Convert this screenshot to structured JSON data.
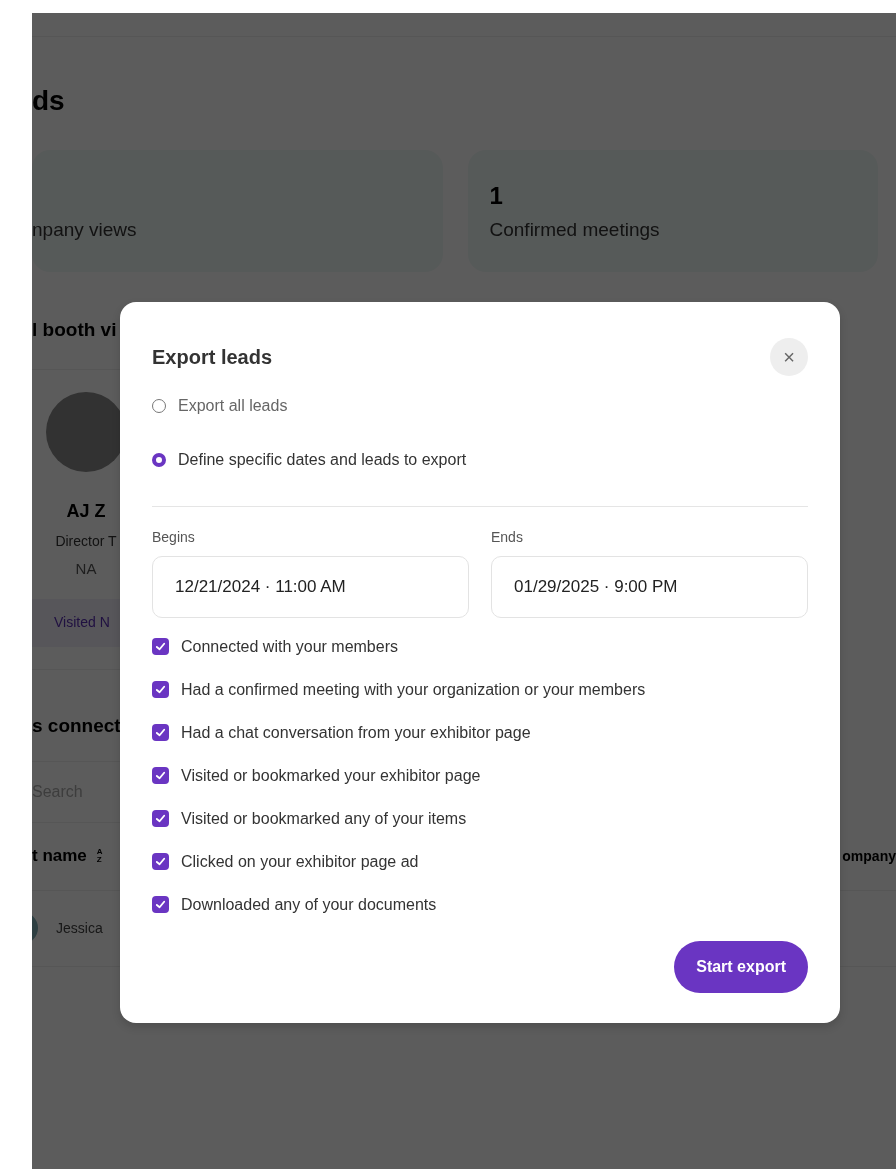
{
  "page": {
    "heading": "ds",
    "stats": [
      {
        "label": "npany views"
      },
      {
        "value": "1",
        "label": "Confirmed meetings"
      }
    ],
    "booth_heading": "l booth vi",
    "person": {
      "name": "AJ Z",
      "title": "Director T",
      "company": "NA",
      "tag": "Visited N"
    },
    "connect_heading": "s connect",
    "search": {
      "placeholder": "Search"
    },
    "table": {
      "columns": [
        {
          "label": "t name",
          "sort": [
            "A",
            "Z"
          ]
        },
        {
          "label": "ompany"
        }
      ],
      "rows": [
        {
          "name": "Jessica"
        }
      ]
    }
  },
  "dialog": {
    "title": "Export leads",
    "close": "×",
    "options": [
      {
        "label": "Export all leads",
        "selected": false
      },
      {
        "label": "Define specific dates and leads to export",
        "selected": true
      }
    ],
    "begins": {
      "label": "Begins",
      "value": "12/21/2024 · 11:00 AM"
    },
    "ends": {
      "label": "Ends",
      "value": "01/29/2025 · 9:00 PM"
    },
    "filters": [
      {
        "label": "Connected with your members",
        "checked": true
      },
      {
        "label": "Had a confirmed meeting with your organization or your members",
        "checked": true
      },
      {
        "label": "Had a chat conversation from your exhibitor page",
        "checked": true
      },
      {
        "label": "Visited or bookmarked your exhibitor page",
        "checked": true
      },
      {
        "label": "Visited or bookmarked any of your items",
        "checked": true
      },
      {
        "label": "Clicked on your exhibitor page ad",
        "checked": true
      },
      {
        "label": "Downloaded any of your documents",
        "checked": true
      }
    ],
    "submit": "Start export"
  }
}
